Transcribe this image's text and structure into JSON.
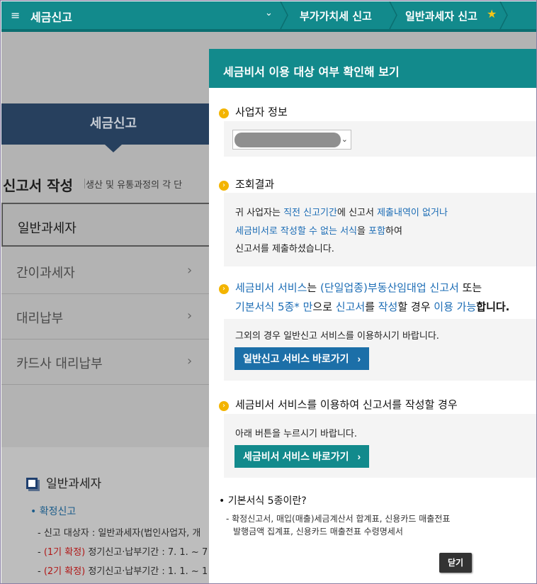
{
  "topbar": {
    "title": "세금신고",
    "crumb1": "부가가치세 신고",
    "crumb2": "일반과세자 신고",
    "menu_icon": "hamburger-icon",
    "chevron_icon": "chevron-down-icon",
    "star_icon": "star-icon",
    "accent": "#128a8c"
  },
  "background": {
    "tab_label": "세금신고",
    "heading": "신고서 작성",
    "heading_sub": "생산 및 유통과정의 각 단",
    "list": [
      {
        "label": "일반과세자",
        "arrow": ""
      },
      {
        "label": "간이과세자",
        "arrow": "›"
      },
      {
        "label": "대리납부",
        "arrow": "›"
      },
      {
        "label": "카드사 대리납부",
        "arrow": "›"
      }
    ],
    "section_title": "일반과세자",
    "section_link": "• 확정신고",
    "line1": "- 신고 대상자 : 일반과세자(법인사업자, 개",
    "line2_dash": "- ",
    "line2_red": "(1기 확정)",
    "line2_rest": " 정기신고·납부기간 : 7. 1. ~ 7",
    "line3_dash": "- ",
    "line3_red": "(2기 확정)",
    "line3_rest": " 정기신고·납부기간 : 1. 1. ~ 1"
  },
  "modal": {
    "title": "세금비서 이용 대상 여부 확인해 보기",
    "section1": "사업자 정보",
    "section2": "조회결과",
    "result": {
      "l1_a": "귀 사업자는 ",
      "l1_b": "직전 신고기간",
      "l1_c": "에 신고서 ",
      "l1_d": "제출내역이 없거나",
      "l2_a": "세금비서로 작성할 수 없는 서식",
      "l2_b": "을 ",
      "l2_c": "포함",
      "l2_d": "하여",
      "l3": "신고서를 제출하셨습니다."
    },
    "intro": {
      "a": "세금비서 서비스",
      "b": "는 ",
      "c": "(단일업종)부동산임대업 신고서",
      "d": " 또는",
      "e": "기본서식 5종* 만",
      "f": "으로 ",
      "g": "신고서",
      "h": "를 ",
      "i": "작성",
      "j": "할 경우 ",
      "k": "이용 가능",
      "l": "합니다."
    },
    "panel3_text": "그외의 경우 일반신고 서비스를 이용하시기 바랍니다.",
    "btn_general": "일반신고 서비스 바로가기",
    "section4": "세금비서 서비스를 이용하여 신고서를 작성할 경우",
    "panel4_text": "아래 버튼을 누르시기 바랍니다.",
    "btn_secretary": "세금비서 서비스 바로가기",
    "btn_arrow": "›",
    "note_title": "• 기본서식 5종이란?",
    "note_l1": "- 확정신고서, 매입(매출)세금계산서 합계표, 신용카드 매출전표",
    "note_l2": "발행금액 집계표, 신용카드 매출전표 수령명세서",
    "close": "닫기"
  }
}
